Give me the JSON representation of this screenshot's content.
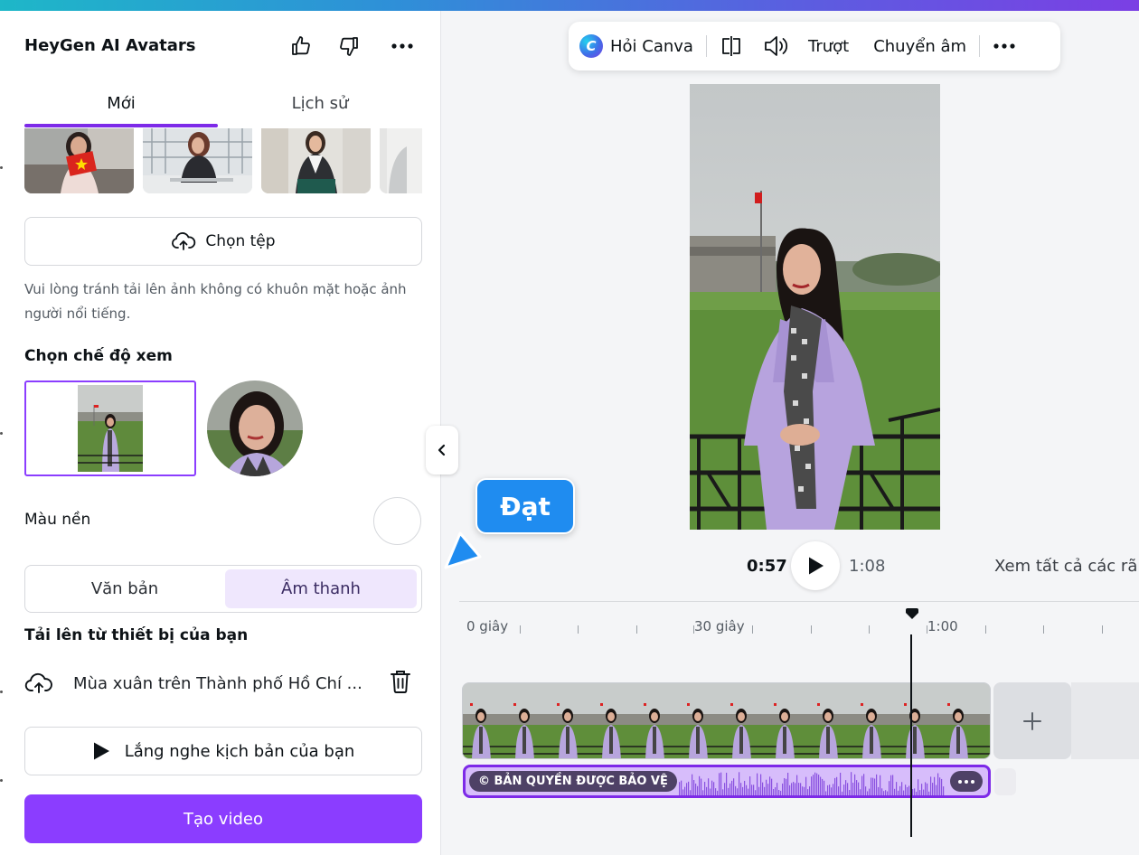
{
  "panel": {
    "title": "HeyGen AI Avatars",
    "tabs": [
      "Mới",
      "Lịch sử"
    ],
    "upload_label": "Chọn tệp",
    "hint": "Vui lòng tránh tải lên ảnh không có khuôn mặt hoặc ảnh người nổi tiếng.",
    "view_mode_title": "Chọn chế độ xem",
    "bg_color_label": "Màu nền",
    "segment": {
      "text": "Văn bản",
      "audio": "Âm thanh"
    },
    "upload_device_title": "Tải lên từ thiết bị của bạn",
    "file_name": "Mùa xuân trên Thành phố Hồ Chí ...",
    "listen_label": "Lắng nghe kịch bản của bạn",
    "create_label": "Tạo video"
  },
  "toolbar": {
    "ask_canva": "Hỏi Canva",
    "slide": "Trượt",
    "transcribe": "Chuyển âm"
  },
  "player": {
    "current_time": "0:57",
    "total_time": "1:08",
    "see_all": "Xem tất cả các rãnh"
  },
  "timeline": {
    "ruler": [
      "0 giây",
      "30 giây",
      "1:00"
    ],
    "audio_label": "© BẢN QUYỀN ĐƯỢC BẢO VỆ"
  },
  "annotation": {
    "cursor_name": "Đạt"
  },
  "colors": {
    "accent": "#8b3dff",
    "cursor": "#1f8cf0",
    "tab_underline": "#7d2ae8"
  }
}
